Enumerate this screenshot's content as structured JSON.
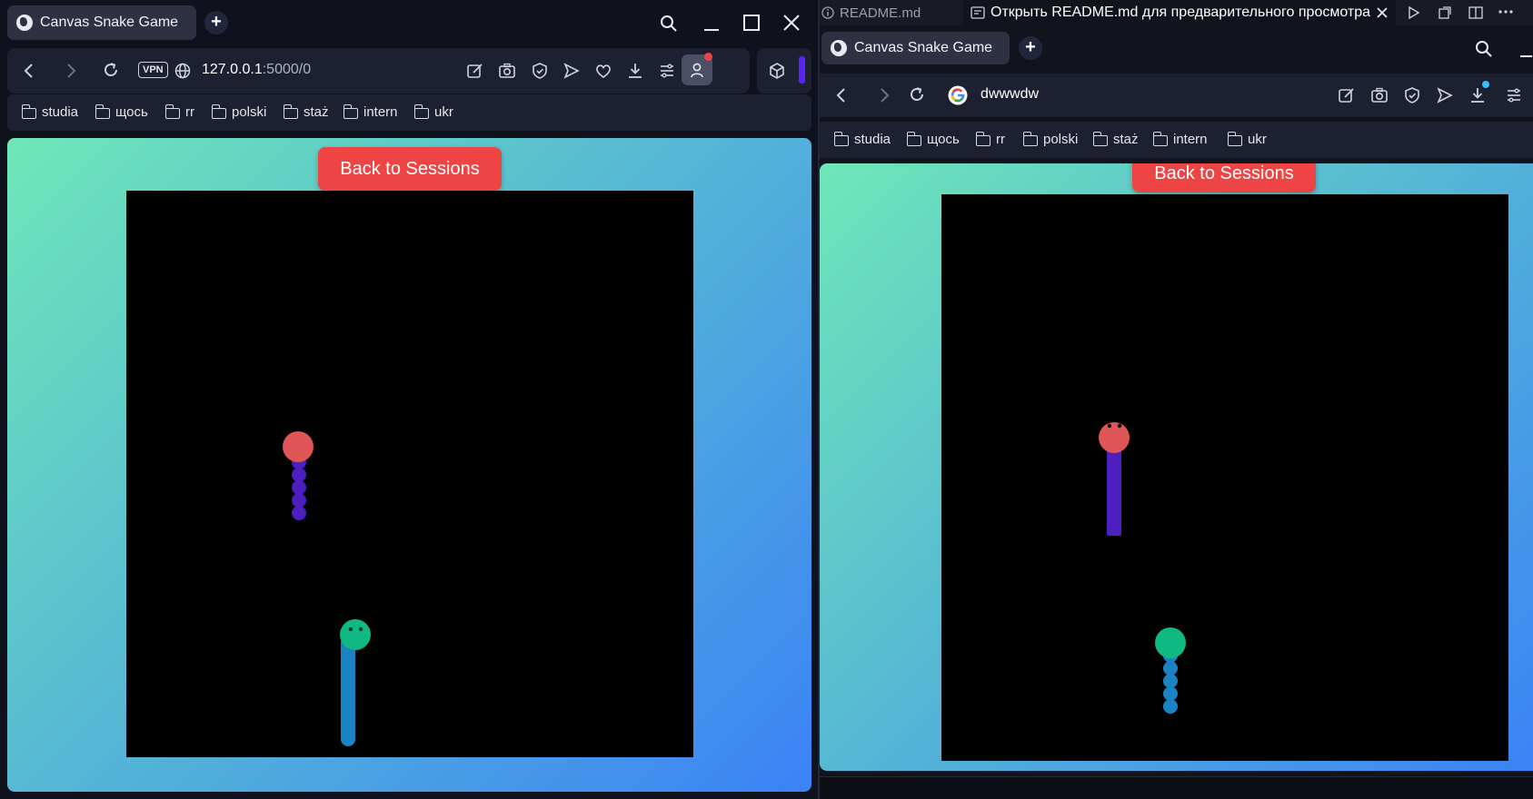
{
  "left_window": {
    "tab": {
      "title": "Canvas Snake Game",
      "icon": "globe-icon"
    },
    "new_tab": "+",
    "toolbar": {
      "vpn_label": "VPN",
      "url_host": "127.0.0.1",
      "url_path": ":5000/0"
    },
    "bookmarks": [
      {
        "label": "studia"
      },
      {
        "label": "щось"
      },
      {
        "label": "rr"
      },
      {
        "label": "polski"
      },
      {
        "label": "staż"
      },
      {
        "label": "intern"
      },
      {
        "label": "ukr"
      }
    ],
    "page": {
      "back_button": "Back to Sessions",
      "background_gradient": [
        "#6ee7b7",
        "#3b82f6"
      ],
      "canvas_background": "#000000"
    }
  },
  "right_window": {
    "editor_tabs": [
      {
        "label": "README.md",
        "icon": "info-icon"
      },
      {
        "label": "Открыть README.md для предварительного просмотра",
        "icon": "preview-icon"
      }
    ],
    "tab": {
      "title": "Canvas Snake Game",
      "icon": "globe-icon"
    },
    "new_tab": "+",
    "toolbar": {
      "search_text": "dwwwdw"
    },
    "bookmarks": [
      {
        "label": "studia"
      },
      {
        "label": "щось"
      },
      {
        "label": "rr"
      },
      {
        "label": "polski"
      },
      {
        "label": "staż"
      },
      {
        "label": "intern"
      },
      {
        "label": "ukr"
      }
    ],
    "page": {
      "back_button": "Back to Sessions",
      "background_gradient": [
        "#6ee7b7",
        "#3b82f6"
      ],
      "canvas_background": "#000000"
    }
  },
  "colors": {
    "snake_red_head": "#e05656",
    "snake_purple_body": "#4b1fc0",
    "snake_green_head": "#10b981",
    "snake_blue_body": "#1b82c4",
    "button_red": "#ef4444"
  }
}
